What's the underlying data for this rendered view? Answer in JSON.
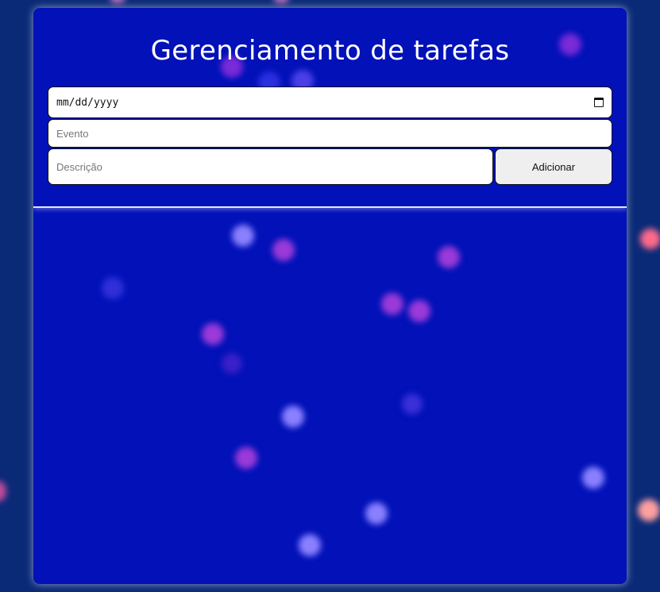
{
  "app": {
    "title": "Gerenciamento de tarefas"
  },
  "form": {
    "date_placeholder": "mm/dd/yyyy",
    "evento_placeholder": "Evento",
    "descricao_placeholder": "Descrição",
    "add_label": "Adicionar"
  },
  "colors": {
    "page_background": "#0a2a78",
    "panel_background": "#0211b8",
    "text": "#ffffff",
    "button_background": "#efefef"
  }
}
